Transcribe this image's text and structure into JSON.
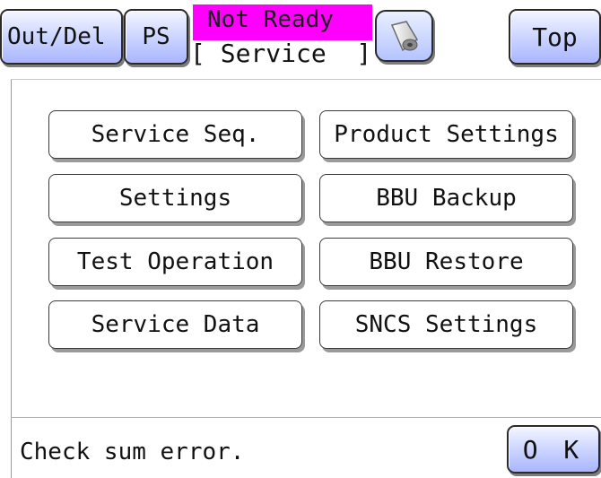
{
  "header": {
    "out_del_label": "Out/Del",
    "ps_label": "PS",
    "status": "Not Ready",
    "mode_title": "[ Service  ]",
    "paper_icon": "paper-roll-icon",
    "top_label": "Top"
  },
  "menu": {
    "items": [
      {
        "label": "Service Seq."
      },
      {
        "label": "Product Settings"
      },
      {
        "label": "Settings"
      },
      {
        "label": "BBU Backup"
      },
      {
        "label": "Test Operation"
      },
      {
        "label": "BBU Restore"
      },
      {
        "label": "Service Data"
      },
      {
        "label": "SNCS Settings"
      }
    ]
  },
  "footer": {
    "message": "Check sum error.",
    "ok_label": "O K"
  },
  "colors": {
    "status_bg": "#ff00ff",
    "blue_button": "#c9d2ff"
  }
}
